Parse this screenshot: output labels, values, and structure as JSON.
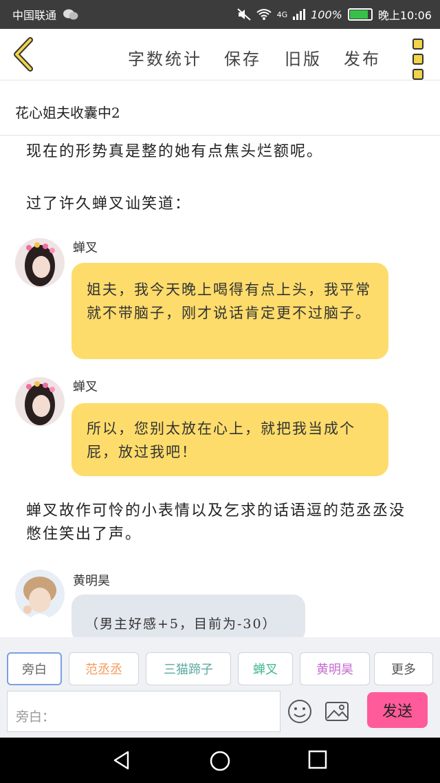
{
  "status_bar": {
    "carrier": "中国联通",
    "network": "4G",
    "battery": "100%",
    "battery_level": 1.0,
    "time": "晚上10:06"
  },
  "toolbar": {
    "word_count": "字数统计",
    "save": "保存",
    "old_version": "旧版",
    "publish": "发布"
  },
  "novel_title": "花心姐夫收囊中2",
  "content": {
    "para1": "现在的形势真是整的她有点焦头烂额呢。",
    "para2": "过了许久蝉叉讪笑道：",
    "msg1": {
      "speaker": "蝉叉",
      "text": "姐夫，我今天晚上喝得有点上头，我平常就不带脑子，刚才说话肯定更不过脑子。"
    },
    "msg2": {
      "speaker": "蝉叉",
      "text": "所以，您别太放在心上，就把我当成个屁，放过我吧！"
    },
    "para3": "蝉叉故作可怜的小表情以及乞求的话语逗的范丞丞没憋住笑出了声。",
    "msg3": {
      "speaker": "黄明昊",
      "text": "（男主好感+5，目前为-30）"
    }
  },
  "characters": [
    {
      "label": "旁白",
      "color": "#666666"
    },
    {
      "label": "范丞丞",
      "color": "#f39a5a"
    },
    {
      "label": "三猫蹄子",
      "color": "#5aa9a0"
    },
    {
      "label": "蝉叉",
      "color": "#3fb98d"
    },
    {
      "label": "黄明昊",
      "color": "#c46bd0"
    },
    {
      "label": "更多",
      "color": "#555555"
    }
  ],
  "input": {
    "placeholder": "旁白："
  },
  "send_label": "发送",
  "colors": {
    "bubble_yellow": "#fddc6b",
    "bubble_gray": "#e2e6ed",
    "send_pink": "#ff5b9a",
    "accent_yellow": "#f2d44a"
  }
}
